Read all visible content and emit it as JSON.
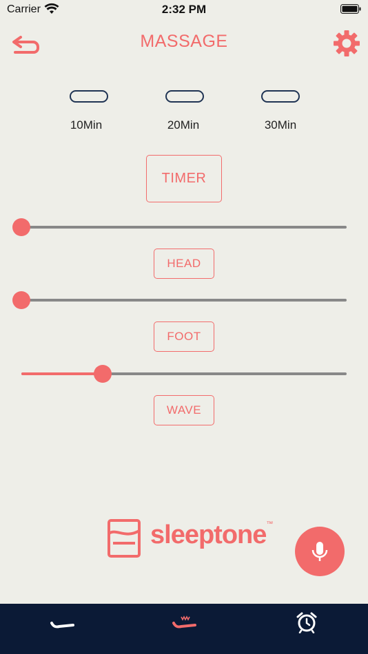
{
  "status_bar": {
    "carrier": "Carrier",
    "time": "2:32 PM"
  },
  "header": {
    "title": "MASSAGE",
    "back_icon": "back-arrow-icon",
    "settings_icon": "gear-icon"
  },
  "timer_options": [
    {
      "label": "10Min"
    },
    {
      "label": "20Min"
    },
    {
      "label": "30Min"
    }
  ],
  "buttons": {
    "timer": "TIMER",
    "head": "HEAD",
    "foot": "FOOT",
    "wave": "WAVE"
  },
  "sliders": {
    "head": {
      "value": 0
    },
    "foot": {
      "value": 0
    },
    "wave": {
      "value": 0.25
    }
  },
  "brand": {
    "name": "sleeptone",
    "mark": "™"
  },
  "mic_fab": {
    "icon": "microphone-icon"
  },
  "bottom_nav": [
    {
      "icon": "bed-flat-icon",
      "active": false
    },
    {
      "icon": "massage-wave-icon",
      "active": true
    },
    {
      "icon": "alarm-clock-icon",
      "active": false
    }
  ],
  "colors": {
    "accent": "#f26b6b",
    "background": "#eeeee8",
    "nav": "#0b1a36",
    "pill_border": "#1f3353",
    "track": "#888888"
  }
}
